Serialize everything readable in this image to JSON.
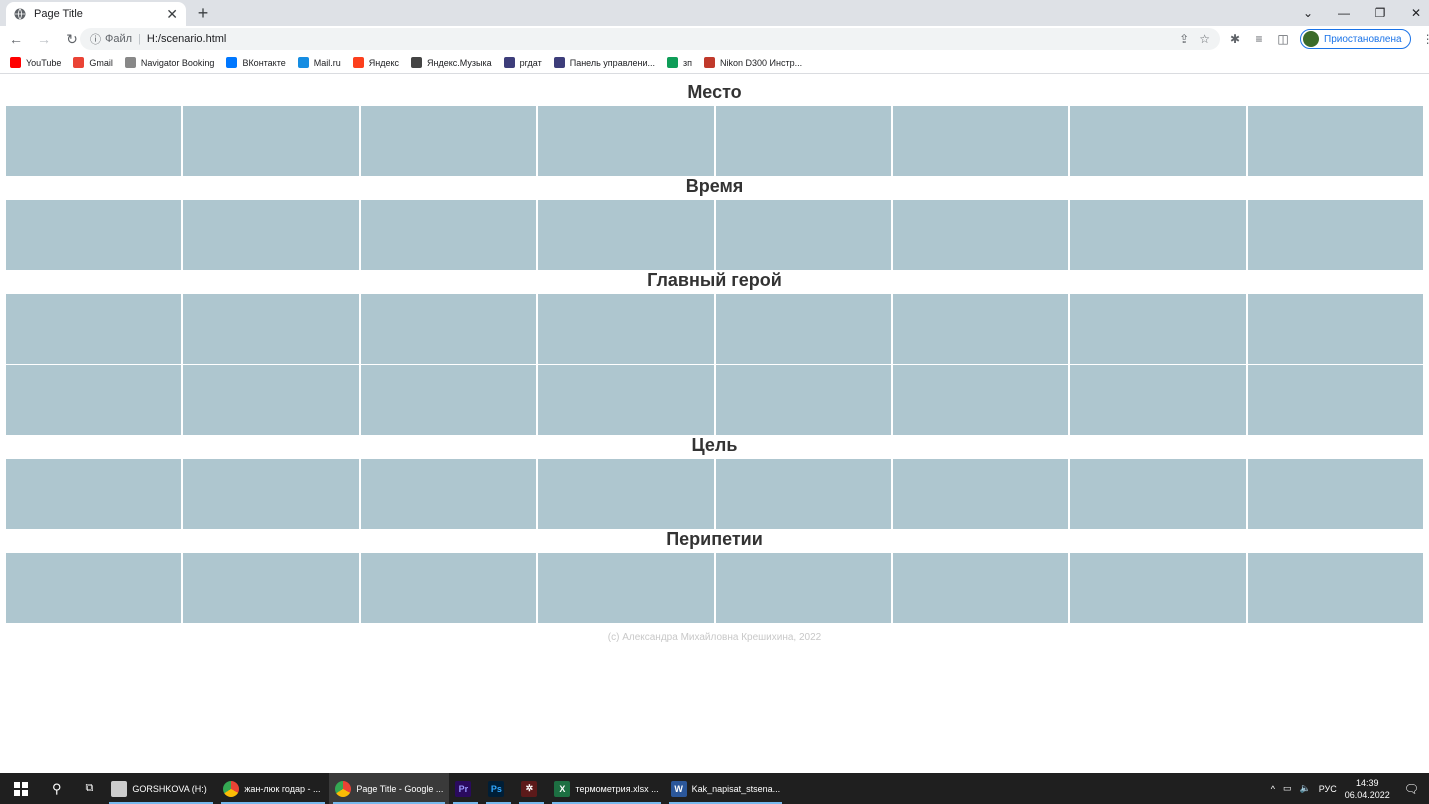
{
  "browser": {
    "tab": {
      "title": "Page Title"
    },
    "address": {
      "file_label": "Файл",
      "url": "H:/scenario.html"
    },
    "profile_status": "Приостановлена",
    "bookmarks": [
      {
        "label": "YouTube",
        "color": "#ff0000"
      },
      {
        "label": "Gmail",
        "color": "#ea4335"
      },
      {
        "label": "Navigator Booking",
        "color": "#888888"
      },
      {
        "label": "ВКонтакте",
        "color": "#0077ff"
      },
      {
        "label": "Mail.ru",
        "color": "#168de2"
      },
      {
        "label": "Яндекс",
        "color": "#fc3f1d"
      },
      {
        "label": "Яндекс.Музыка",
        "color": "#444444"
      },
      {
        "label": "ргдат",
        "color": "#3d3d7a"
      },
      {
        "label": "Панель управлени...",
        "color": "#3d3d7a"
      },
      {
        "label": "зп",
        "color": "#0f9d58"
      },
      {
        "label": "Nikon D300 Инстр...",
        "color": "#c0392b"
      }
    ]
  },
  "page": {
    "sections": [
      {
        "title": "Место",
        "rows": 1
      },
      {
        "title": "Время",
        "rows": 1
      },
      {
        "title": "Главный герой",
        "rows": 2
      },
      {
        "title": "Цель",
        "rows": 1
      },
      {
        "title": "Перипетии",
        "rows": 1
      }
    ],
    "columns": 8,
    "cell_color": "#aec6cf",
    "footer": "(c) Александра Михайловна Крешихина, 2022"
  },
  "taskbar": {
    "items": [
      {
        "label": "GORSHKOVA (H:)",
        "icon": "drive-icon",
        "color": "#cccccc"
      },
      {
        "label": "жан-люк годар - ...",
        "icon": "chrome-icon",
        "color": "#34a853"
      },
      {
        "label": "Page Title - Google ...",
        "icon": "chrome-icon",
        "color": "#34a853"
      },
      {
        "label": "",
        "icon": "premiere-icon",
        "color": "#2a0a5e",
        "text": "Pr"
      },
      {
        "label": "",
        "icon": "photoshop-icon",
        "color": "#001e36",
        "text": "Ps"
      },
      {
        "label": "",
        "icon": "app-icon",
        "color": "#5c1a1a",
        "text": "✲"
      },
      {
        "label": "термометрия.xlsx ...",
        "icon": "excel-icon",
        "color": "#1d6f42",
        "text": "X"
      },
      {
        "label": "Kak_napisat_stsena...",
        "icon": "word-icon",
        "color": "#2b579a",
        "text": "W"
      }
    ],
    "lang": "РУС",
    "time": "14:39",
    "date": "06.04.2022"
  }
}
